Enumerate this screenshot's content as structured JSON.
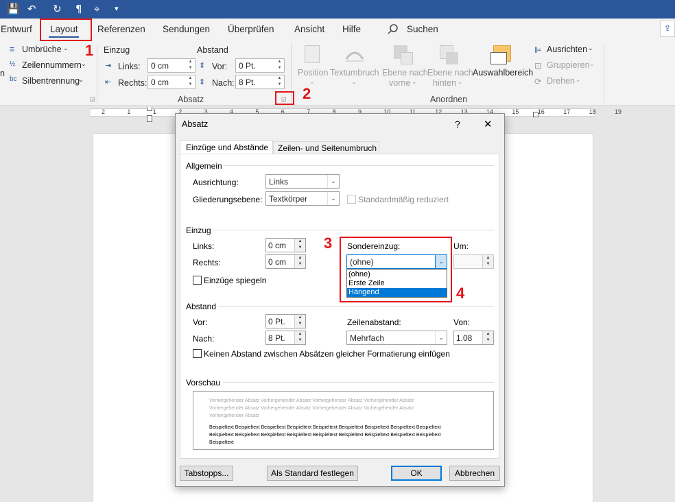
{
  "quickaccess": {
    "save": "💾",
    "undo": "↶",
    "redo": "↻",
    "pilcrow": "¶",
    "touch": "⌖",
    "more": "▾"
  },
  "tabs": [
    "Entwurf",
    "Layout",
    "Referenzen",
    "Sendungen",
    "Überprüfen",
    "Ansicht",
    "Hilfe"
  ],
  "search": {
    "label": "Suchen"
  },
  "ribbon": {
    "pagesetup": {
      "umbrueche": "Umbrüche",
      "zeilennummern": "Zeilennummern",
      "silbentrennung": "Silbentrennung"
    },
    "absatz": {
      "einzug_label": "Einzug",
      "abstand_label": "Abstand",
      "links_label": "Links:",
      "links_value": "0 cm",
      "rechts_label": "Rechts:",
      "rechts_value": "0 cm",
      "vor_label": "Vor:",
      "vor_value": "0 Pt.",
      "nach_label": "Nach:",
      "nach_value": "8 Pt.",
      "group_label": "Absatz"
    },
    "anordnen": {
      "position": "Position",
      "textumbruch": "Textumbruch",
      "ebene_vorne_1": "Ebene nach",
      "ebene_vorne_2": "vorne",
      "ebene_hinten_1": "Ebene nach",
      "ebene_hinten_2": "hinten",
      "auswahlbereich": "Auswahlbereich",
      "ausrichten": "Ausrichten",
      "gruppieren": "Gruppieren",
      "drehen": "Drehen",
      "group_label": "Anordnen"
    }
  },
  "ruler": {
    "marks": [
      "2",
      "1",
      "1",
      "2",
      "3",
      "4",
      "5",
      "6",
      "7",
      "8",
      "9",
      "10",
      "11",
      "12",
      "13",
      "14",
      "15",
      "16",
      "17",
      "18",
      "19"
    ]
  },
  "dialog": {
    "title": "Absatz",
    "help": "?",
    "close": "✕",
    "tab1": "Einzüge und Abstände",
    "tab2": "Zeilen- und Seitenumbruch",
    "allgemein": {
      "section": "Allgemein",
      "ausrichtung_label": "Ausrichtung:",
      "ausrichtung_value": "Links",
      "gliederung_label": "Gliederungsebene:",
      "gliederung_value": "Textkörper",
      "standard_reduziert": "Standardmäßig reduziert"
    },
    "einzug": {
      "section": "Einzug",
      "links_label": "Links:",
      "links_value": "0 cm",
      "rechts_label": "Rechts:",
      "rechts_value": "0 cm",
      "spiegeln": "Einzüge spiegeln",
      "sonder_label": "Sondereinzug:",
      "sonder_value": "(ohne)",
      "sonder_options": [
        "(ohne)",
        "Erste Zeile",
        "Hängend"
      ],
      "um_label": "Um:"
    },
    "abstand": {
      "section": "Abstand",
      "vor_label": "Vor:",
      "vor_value": "0 Pt.",
      "nach_label": "Nach:",
      "nach_value": "8 Pt.",
      "zeilen_label": "Zeilenabstand:",
      "zeilen_value": "Mehrfach",
      "von_label": "Von:",
      "von_value": "1.08",
      "keinen": "Keinen Abstand zwischen Absätzen gleicher Formatierung einfügen"
    },
    "vorschau": {
      "section": "Vorschau",
      "prev_lines": [
        "Vorhergehender Absatz Vorhergehender Absatz Vorhergehender Absatz Vorhergehender Absatz",
        "Vorhergehender Absatz Vorhergehender Absatz Vorhergehender Absatz Vorhergehender Absatz",
        "Vorhergehender Absatz"
      ],
      "sample_lines": [
        "Beispieltext Beispieltext Beispieltext Beispieltext Beispieltext Beispieltext Beispieltext Beispieltext Beispieltext",
        "Beispieltext Beispieltext Beispieltext Beispieltext Beispieltext Beispieltext Beispieltext Beispieltext Beispieltext",
        "Beispieltext"
      ]
    },
    "buttons": {
      "tabstopps": "Tabstopps...",
      "standard": "Als Standard festlegen",
      "ok": "OK",
      "abbrechen": "Abbrechen"
    }
  },
  "annotations": [
    "1",
    "2",
    "3",
    "4"
  ],
  "colors": {
    "accent": "#2b579a",
    "annotation": "#e1161a",
    "selection": "#0078d7"
  }
}
